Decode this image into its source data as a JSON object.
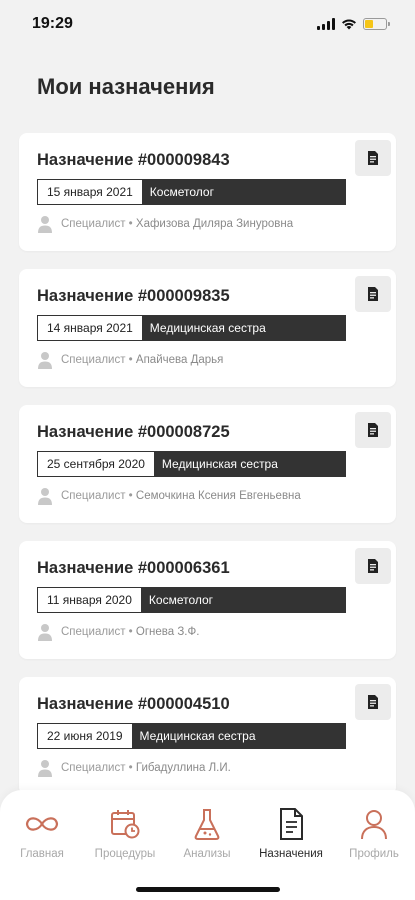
{
  "status_bar": {
    "time": "19:29"
  },
  "page": {
    "title": "Мои назначения"
  },
  "appointments": [
    {
      "title": "Назначение #000009843",
      "date": "15 января 2021",
      "role": "Косметолог",
      "specialist_prefix": "Специалист • ",
      "specialist_name": "Хафизова Диляра Зинуровна"
    },
    {
      "title": "Назначение #000009835",
      "date": "14 января 2021",
      "role": "Медицинская сестра",
      "specialist_prefix": "Специалист • ",
      "specialist_name": "Апайчева Дарья"
    },
    {
      "title": "Назначение #000008725",
      "date": "25 сентября 2020",
      "role": "Медицинская сестра",
      "specialist_prefix": "Специалист • ",
      "specialist_name": "Семочкина Ксения Евгеньевна"
    },
    {
      "title": "Назначение #000006361",
      "date": "11 января 2020",
      "role": "Косметолог",
      "specialist_prefix": "Специалист • ",
      "specialist_name": "Огнева З.Ф."
    },
    {
      "title": "Назначение #000004510",
      "date": "22 июня 2019",
      "role": "Медицинская сестра",
      "specialist_prefix": "Специалист • ",
      "specialist_name": "Гибадуллина Л.И."
    }
  ],
  "tabbar": {
    "tabs": [
      {
        "label": "Главная",
        "icon": "infinity-icon",
        "active": false
      },
      {
        "label": "Процедуры",
        "icon": "calendar-clock-icon",
        "active": false
      },
      {
        "label": "Анализы",
        "icon": "flask-icon",
        "active": false
      },
      {
        "label": "Назначения",
        "icon": "document-icon",
        "active": true
      },
      {
        "label": "Профиль",
        "icon": "person-icon",
        "active": false
      }
    ]
  },
  "colors": {
    "accent": "#c9705a",
    "dark": "#333333",
    "muted": "#a8a8a8",
    "battery": "#f5c518"
  }
}
